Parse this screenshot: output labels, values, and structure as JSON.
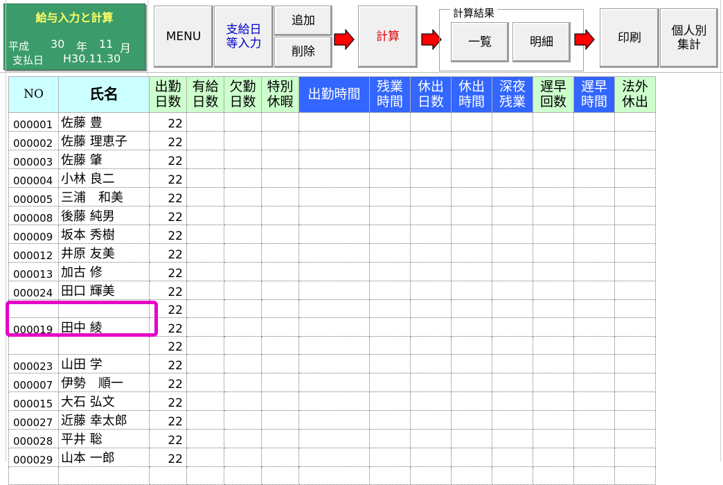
{
  "infobox": {
    "title": "給与入力と計算",
    "era": "平成",
    "year": "30",
    "year_unit": "年",
    "month": "11",
    "month_unit": "月",
    "pay_label": "支払日",
    "pay_date": "H30.11.30",
    "bg_color": "#3b9b6a",
    "title_color": "#ffff66"
  },
  "toolbar": {
    "menu": "MENU",
    "paydate_line1": "支給日",
    "paydate_line2": "等入力",
    "add": "追加",
    "delete": "削除",
    "calc": "計算",
    "results_group": "計算結果",
    "list": "一覧",
    "detail": "明細",
    "print": "印刷",
    "personal_line1": "個人別",
    "personal_line2": "集計",
    "calc_color": "#e00000",
    "blue_text_color": "#0000cc",
    "arrow_color": "#ff0000"
  },
  "headers": {
    "no": "NO",
    "name": "氏名",
    "work_days": [
      "出勤",
      "日数"
    ],
    "paid_leave": [
      "有給",
      "日数"
    ],
    "absent_days": [
      "欠勤",
      "日数"
    ],
    "special_leave": [
      "特別",
      "休暇"
    ],
    "work_hours": "出勤時間",
    "overtime": [
      "残業",
      "時間"
    ],
    "holiday_days": [
      "休出",
      "日数"
    ],
    "holiday_hours": [
      "休出",
      "時間"
    ],
    "night_overtime": [
      "深夜",
      "残業"
    ],
    "late_count": [
      "遅早",
      "回数"
    ],
    "late_hours": [
      "遅早",
      "時間"
    ],
    "legal_holiday": [
      "法外",
      "休出"
    ]
  },
  "rows": [
    {
      "no": "000001",
      "name": "佐藤 豊",
      "days": "22"
    },
    {
      "no": "000002",
      "name": "佐藤 理恵子",
      "days": "22"
    },
    {
      "no": "000003",
      "name": "佐藤 肇",
      "days": "22"
    },
    {
      "no": "000004",
      "name": "小林 良二",
      "days": "22"
    },
    {
      "no": "000005",
      "name": "三浦　和美",
      "days": "22"
    },
    {
      "no": "000008",
      "name": "後藤 純男",
      "days": "22"
    },
    {
      "no": "000009",
      "name": "坂本 秀樹",
      "days": "22"
    },
    {
      "no": "000012",
      "name": "井原 友美",
      "days": "22"
    },
    {
      "no": "000013",
      "name": "加古 修",
      "days": "22"
    },
    {
      "no": "000024",
      "name": "田口 輝美",
      "days": "22"
    },
    {
      "no": "",
      "name": "",
      "days": "22"
    },
    {
      "no": "000019",
      "name": "田中 綾",
      "days": "22"
    },
    {
      "no": "",
      "name": "",
      "days": "22"
    },
    {
      "no": "000023",
      "name": "山田 学",
      "days": "22"
    },
    {
      "no": "000007",
      "name": "伊勢　順一",
      "days": "22"
    },
    {
      "no": "000015",
      "name": "大石 弘文",
      "days": "22"
    },
    {
      "no": "000027",
      "name": "近藤 幸太郎",
      "days": "22"
    },
    {
      "no": "000028",
      "name": "平井 聡",
      "days": "22"
    },
    {
      "no": "000029",
      "name": "山本 一郎",
      "days": "22"
    },
    {
      "no": "",
      "name": "",
      "days": ""
    }
  ],
  "highlight_color": "#e600c8"
}
